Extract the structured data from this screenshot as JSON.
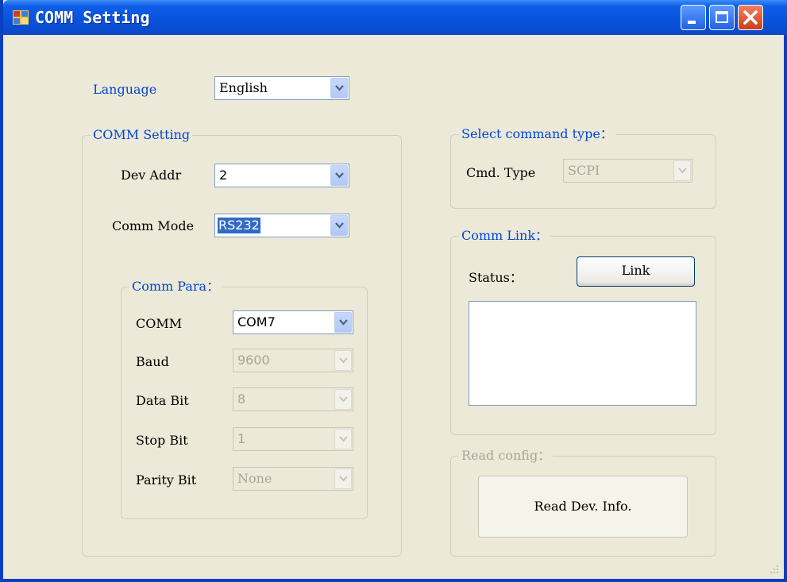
{
  "window": {
    "title": "COMM Setting",
    "minimize_icon": "minimize-icon",
    "maximize_icon": "maximize-icon",
    "close_icon": "close-icon"
  },
  "language": {
    "label": "Language",
    "value": "English"
  },
  "comm_setting": {
    "title": "COMM Setting",
    "dev_addr": {
      "label": "Dev Addr",
      "value": "2"
    },
    "comm_mode": {
      "label": "Comm Mode",
      "value": "RS232"
    },
    "comm_para": {
      "title": "Comm Para：",
      "comm": {
        "label": "COMM",
        "value": "COM7"
      },
      "baud": {
        "label": "Baud",
        "value": "9600"
      },
      "data_bit": {
        "label": "Data Bit",
        "value": "8"
      },
      "stop_bit": {
        "label": "Stop Bit",
        "value": "1"
      },
      "parity_bit": {
        "label": "Parity Bit",
        "value": "None"
      }
    }
  },
  "select_command_type": {
    "title": "Select command type：",
    "cmd_type": {
      "label": "Cmd. Type",
      "value": "SCPI"
    }
  },
  "comm_link": {
    "title": "Comm Link：",
    "status_label": "Status：",
    "link_button": "Link",
    "status_text": ""
  },
  "read_config": {
    "title": "Read config：",
    "read_button": "Read Dev. Info."
  },
  "colors": {
    "title_bar": "#0852db",
    "window_bg": "#ece9d8",
    "group_title": "#0046d5",
    "disabled_text": "#a8a59a",
    "selection": "#316ac5"
  }
}
